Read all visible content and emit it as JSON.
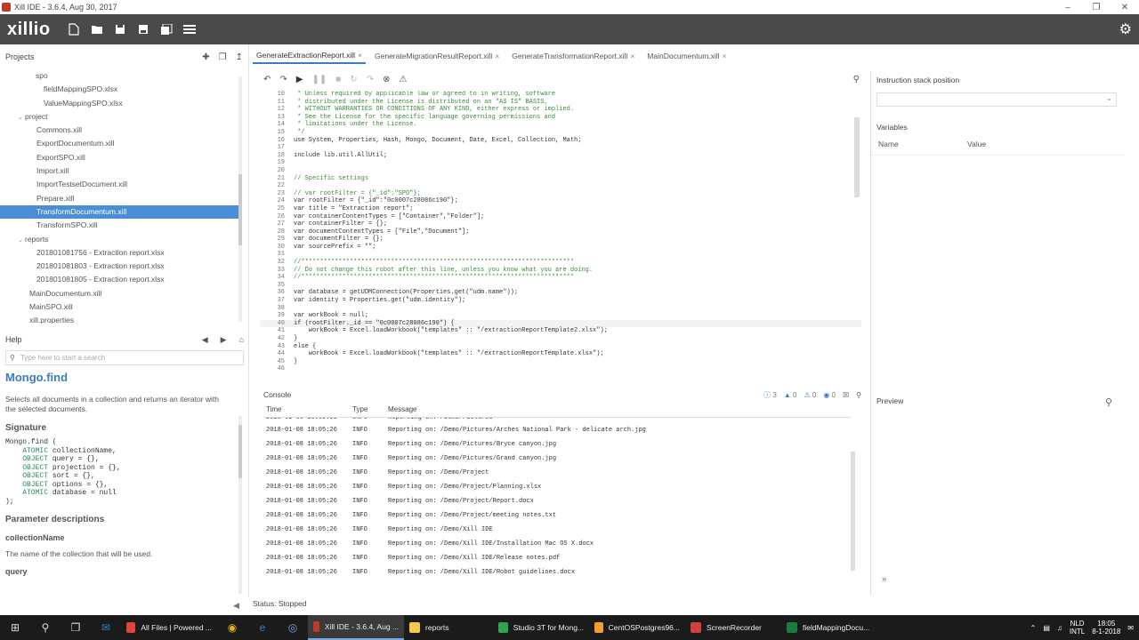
{
  "window": {
    "title": "Xill IDE - 3.6.4, Aug 30, 2017"
  },
  "toolbar": {
    "logo": "xillio"
  },
  "projects": {
    "header": "Projects",
    "tree": [
      {
        "label": "spo",
        "indent": 40,
        "arrow": ""
      },
      {
        "label": "fieldMappingSPO.xlsx",
        "indent": 49,
        "arrow": ""
      },
      {
        "label": "ValueMappingSPO.xlsx",
        "indent": 49,
        "arrow": ""
      },
      {
        "label": "project",
        "indent": 22,
        "arrow": "⌄"
      },
      {
        "label": "Commons.xill",
        "indent": 41,
        "arrow": ""
      },
      {
        "label": "ExportDocumentum.xill",
        "indent": 41,
        "arrow": ""
      },
      {
        "label": "ExportSPO.xill",
        "indent": 41,
        "arrow": ""
      },
      {
        "label": "Import.xill",
        "indent": 41,
        "arrow": ""
      },
      {
        "label": "ImportTestsetDocument.xill",
        "indent": 41,
        "arrow": ""
      },
      {
        "label": "Prepare.xill",
        "indent": 41,
        "arrow": ""
      },
      {
        "label": "TransformDocumentum.xill",
        "indent": 41,
        "arrow": "",
        "selected": true
      },
      {
        "label": "TransformSPO.xill",
        "indent": 41,
        "arrow": ""
      },
      {
        "label": "reports",
        "indent": 22,
        "arrow": "⌄"
      },
      {
        "label": "201801081756 - Extraction report.xlsx",
        "indent": 41,
        "arrow": ""
      },
      {
        "label": "201801081803 - Extraction report.xlsx",
        "indent": 41,
        "arrow": ""
      },
      {
        "label": "201801081805 - Extraction report.xlsx",
        "indent": 41,
        "arrow": ""
      },
      {
        "label": "MainDocumentum.xill",
        "indent": 33,
        "arrow": ""
      },
      {
        "label": "MainSPO.xill",
        "indent": 33,
        "arrow": ""
      },
      {
        "label": "xill.properties",
        "indent": 33,
        "arrow": ""
      }
    ]
  },
  "help": {
    "header": "Help",
    "search_placeholder": "Type here to start a search",
    "function_name": "Mongo.find",
    "description": "Selects all documents in a collection and returns an iterator with the selected documents.",
    "signature_title": "Signature",
    "signature": [
      {
        "parts": [
          [
            "plain",
            "Mongo.find ("
          ]
        ]
      },
      {
        "parts": [
          [
            "tp",
            "    ATOMIC "
          ],
          [
            "plain",
            "collectionName,"
          ]
        ]
      },
      {
        "parts": [
          [
            "tp",
            "    OBJECT "
          ],
          [
            "plain",
            "query = {},"
          ]
        ]
      },
      {
        "parts": [
          [
            "tp",
            "    OBJECT "
          ],
          [
            "plain",
            "projection = {},"
          ]
        ]
      },
      {
        "parts": [
          [
            "tp",
            "    OBJECT "
          ],
          [
            "plain",
            "sort = {},"
          ]
        ]
      },
      {
        "parts": [
          [
            "tp",
            "    OBJECT "
          ],
          [
            "plain",
            "options = {},"
          ]
        ]
      },
      {
        "parts": [
          [
            "tp",
            "    ATOMIC "
          ],
          [
            "plain",
            "database = null"
          ]
        ]
      },
      {
        "parts": [
          [
            "plain",
            ");"
          ]
        ]
      }
    ],
    "params_title": "Parameter descriptions",
    "param1_name": "collectionName",
    "param1_desc": "The name of the collection that will be used.",
    "param2_name": "query"
  },
  "tabs": [
    {
      "label": "GenerateExtractionReport.xill",
      "active": true
    },
    {
      "label": "GenerateMigrationResultReport.xill",
      "active": false
    },
    {
      "label": "GenerateTransformationReport.xill",
      "active": false
    },
    {
      "label": "MainDocumentum.xill",
      "active": false
    }
  ],
  "code": [
    {
      "n": "10",
      "t": " * Unless required by applicable law or agreed to in writing, software",
      "c": true
    },
    {
      "n": "11",
      "t": " * distributed under the License is distributed on an \"AS IS\" BASIS,",
      "c": true
    },
    {
      "n": "12",
      "t": " * WITHOUT WARRANTIES OR CONDITIONS OF ANY KIND, either express or implied.",
      "c": true
    },
    {
      "n": "13",
      "t": " * See the License for the specific language governing permissions and",
      "c": true
    },
    {
      "n": "14",
      "t": " * limitations under the License.",
      "c": true
    },
    {
      "n": "15",
      "t": " */",
      "c": true
    },
    {
      "n": "16",
      "t": "use System, Properties, Hash, Mongo, Document, Date, Excel, Collection, Math;"
    },
    {
      "n": "17",
      "t": ""
    },
    {
      "n": "18",
      "t": "include lib.util.AllUtil;"
    },
    {
      "n": "19",
      "t": ""
    },
    {
      "n": "20",
      "t": ""
    },
    {
      "n": "21",
      "t": "// Specific settings",
      "c": true
    },
    {
      "n": "22",
      "t": ""
    },
    {
      "n": "23",
      "t": "// var rootFilter = {\"_id\":\"SPO\"};",
      "c": true
    },
    {
      "n": "24",
      "t": "var rootFilter = {\"_id\":\"0c0007c28086c190\"};"
    },
    {
      "n": "25",
      "t": "var title = \"Extraction report\";"
    },
    {
      "n": "26",
      "t": "var containerContentTypes = [\"Container\",\"Folder\"];"
    },
    {
      "n": "27",
      "t": "var containerFilter = {};"
    },
    {
      "n": "28",
      "t": "var documentContentTypes = [\"File\",\"Document\"];"
    },
    {
      "n": "29",
      "t": "var documentFilter = {};"
    },
    {
      "n": "30",
      "t": "var sourcePrefix = \"\";"
    },
    {
      "n": "31",
      "t": ""
    },
    {
      "n": "32",
      "t": "//*************************************************************************",
      "c": true
    },
    {
      "n": "33",
      "t": "// Do not change this robot after this line, unless you know what you are doing.",
      "c": true
    },
    {
      "n": "34",
      "t": "//*************************************************************************",
      "c": true
    },
    {
      "n": "35",
      "t": ""
    },
    {
      "n": "36",
      "t": "var database = getUDMConnection(Properties.get(\"udm.name\"));"
    },
    {
      "n": "37",
      "t": "var identity = Properties.get(\"udm.identity\");"
    },
    {
      "n": "38",
      "t": ""
    },
    {
      "n": "39",
      "t": "var workBook = null;"
    },
    {
      "n": "40",
      "t": "if (rootFilter._id == \"0c0007c28086c190\") {",
      "cur": true
    },
    {
      "n": "41",
      "t": "    workBook = Excel.loadWorkbook(\"templates\" :: \"/extractionReportTemplate2.xlsx\");"
    },
    {
      "n": "42",
      "t": "}"
    },
    {
      "n": "43",
      "t": "else {"
    },
    {
      "n": "44",
      "t": "    workBook = Excel.loadWorkbook(\"templates\" :: \"/extractionReportTemplate.xlsx\");"
    },
    {
      "n": "45",
      "t": "}"
    },
    {
      "n": "46",
      "t": ""
    }
  ],
  "console": {
    "title": "Console",
    "counts": {
      "info": "3",
      "warn": "0",
      "error": "0",
      "fatal": "0"
    },
    "columns": {
      "time": "Time",
      "type": "Type",
      "message": "Message"
    },
    "rows": [
      {
        "time": "2018-01-08 18:05:26",
        "type": "INFO",
        "msg": "Reporting on: /Demo/Pictures"
      },
      {
        "time": "2018-01-08 18:05:26",
        "type": "INFO",
        "msg": "Reporting on: /Demo/Pictures/Arches National Park - delicate arch.jpg"
      },
      {
        "time": "2018-01-08 18:05:26",
        "type": "INFO",
        "msg": "Reporting on: /Demo/Pictures/Bryce canyon.jpg"
      },
      {
        "time": "2018-01-08 18:05:26",
        "type": "INFO",
        "msg": "Reporting on: /Demo/Pictures/Grand canyon.jpg"
      },
      {
        "time": "2018-01-08 18:05:26",
        "type": "INFO",
        "msg": "Reporting on: /Demo/Project"
      },
      {
        "time": "2018-01-08 18:05:26",
        "type": "INFO",
        "msg": "Reporting on: /Demo/Project/Planning.xlsx"
      },
      {
        "time": "2018-01-08 18:05:26",
        "type": "INFO",
        "msg": "Reporting on: /Demo/Project/Report.docx"
      },
      {
        "time": "2018-01-08 18:05:26",
        "type": "INFO",
        "msg": "Reporting on: /Demo/Project/meeting notes.txt"
      },
      {
        "time": "2018-01-08 18:05:26",
        "type": "INFO",
        "msg": "Reporting on: /Demo/Xill IDE"
      },
      {
        "time": "2018-01-08 18:05:26",
        "type": "INFO",
        "msg": "Reporting on: /Demo/Xill IDE/Installation Mac OS X.docx"
      },
      {
        "time": "2018-01-08 18:05:26",
        "type": "INFO",
        "msg": "Reporting on: /Demo/Xill IDE/Release notes.pdf"
      },
      {
        "time": "2018-01-08 18:05:26",
        "type": "INFO",
        "msg": "Reporting on: /Demo/Xill IDE/Robot guidelines.docx"
      }
    ]
  },
  "right": {
    "instruction_stack": "Instruction stack position",
    "variables": "Variables",
    "col_name": "Name",
    "col_value": "Value",
    "preview": "Preview"
  },
  "status": {
    "text": "Status:  Stopped"
  },
  "taskbar": {
    "apps": [
      {
        "label": "All Files | Powered ...",
        "color": "#e0443a",
        "active": false
      },
      {
        "label": "Xill IDE - 3.6.4, Aug ...",
        "color": "#c0392b",
        "active": true
      },
      {
        "label": "reports",
        "color": "#f2c94c",
        "active": false
      },
      {
        "label": "Studio 3T for Mong...",
        "color": "#2ea44f",
        "active": false
      },
      {
        "label": "CentOSPostgres96...",
        "color": "#f0a030",
        "active": false
      },
      {
        "label": "ScreenRecorder",
        "color": "#d04040",
        "active": false
      },
      {
        "label": "fieldMappingDocu...",
        "color": "#1f7a3f",
        "active": false
      }
    ],
    "lang_top": "NLD",
    "lang_bottom": "INTL",
    "time": "18:05",
    "date": "8-1-2018"
  }
}
